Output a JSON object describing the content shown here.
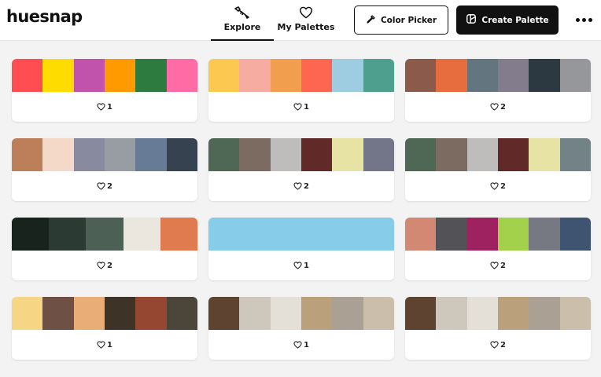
{
  "app": {
    "logo": "huesnap"
  },
  "nav": {
    "tabs": [
      {
        "label": "Explore",
        "icon": "eyedropper-explore-icon",
        "active": true
      },
      {
        "label": "My Palettes",
        "icon": "heart-icon",
        "active": false
      }
    ]
  },
  "actions": {
    "color_picker_label": "Color Picker",
    "color_picker_icon": "eyedropper-icon",
    "create_palette_label": "Create Palette",
    "create_palette_icon": "palette-icon",
    "more_icon": "more-dots-icon"
  },
  "palettes": [
    {
      "colors": [
        "#ff4d52",
        "#ffdc00",
        "#c153ad",
        "#ff9b00",
        "#2e7b3f",
        "#ff6ba5"
      ],
      "likes": "1"
    },
    {
      "colors": [
        "#fdc84f",
        "#f6aca1",
        "#f19f4f",
        "#fe6651",
        "#9ecce0",
        "#4e9f8d"
      ],
      "likes": "1"
    },
    {
      "colors": [
        "#8c5a4b",
        "#e76c3e",
        "#637680",
        "#837c8d",
        "#2c3940",
        "#96979b"
      ],
      "likes": "2"
    },
    {
      "colors": [
        "#bd7f59",
        "#f4d9c9",
        "#888aa0",
        "#979da3",
        "#677b96",
        "#374250"
      ],
      "likes": "2"
    },
    {
      "colors": [
        "#4f6855",
        "#7b6b61",
        "#bebdbb",
        "#612928",
        "#e7e3a4",
        "#737689"
      ],
      "likes": "2"
    },
    {
      "colors": [
        "#4f6855",
        "#7b6b61",
        "#bebdbb",
        "#612928",
        "#e7e3a4",
        "#738287"
      ],
      "likes": "2"
    },
    {
      "colors": [
        "#19231e",
        "#2c3a34",
        "#4d6055",
        "#ebe6de",
        "#e07a4f"
      ],
      "likes": "2"
    },
    {
      "colors": [
        "#87cdea"
      ],
      "likes": "1"
    },
    {
      "colors": [
        "#d28873",
        "#535256",
        "#9e2160",
        "#a3d14b",
        "#767981",
        "#3e5470"
      ],
      "likes": "2"
    },
    {
      "colors": [
        "#f6d584",
        "#6e5144",
        "#e9ae78",
        "#3e3327",
        "#964731",
        "#4b4639"
      ],
      "likes": "1"
    },
    {
      "colors": [
        "#5e4430",
        "#cec7bb",
        "#e5e0d7",
        "#bba07c",
        "#aaa093",
        "#cbbfac"
      ],
      "likes": "1"
    },
    {
      "colors": [
        "#5e4430",
        "#cec7bb",
        "#e5e0d7",
        "#bba07c",
        "#aaa093",
        "#cbbfac"
      ],
      "likes": "2"
    }
  ]
}
